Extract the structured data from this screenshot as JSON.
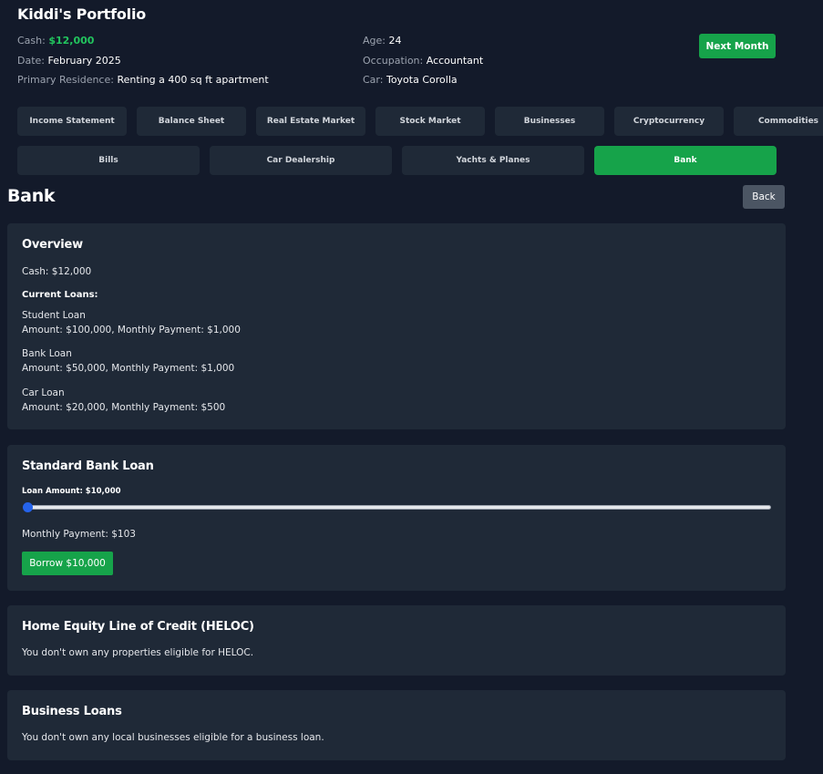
{
  "header": {
    "title": "Kiddi's Portfolio",
    "cash_label": "Cash:",
    "cash_value": "$12,000",
    "date_label": "Date:",
    "date_value": "February 2025",
    "residence_label": "Primary Residence:",
    "residence_value": "Renting a 400 sq ft apartment",
    "age_label": "Age:",
    "age_value": "24",
    "occupation_label": "Occupation:",
    "occupation_value": "Accountant",
    "car_label": "Car:",
    "car_value": "Toyota Corolla",
    "next_month_label": "Next Month"
  },
  "tabs_row1": [
    "Income Statement",
    "Balance Sheet",
    "Real Estate Market",
    "Stock Market",
    "Businesses",
    "Cryptocurrency",
    "Commodities"
  ],
  "tabs_row2": [
    "Bills",
    "Car Dealership",
    "Yachts & Planes",
    "Bank"
  ],
  "active_tab": "Bank",
  "page": {
    "title": "Bank",
    "back_label": "Back"
  },
  "overview": {
    "heading": "Overview",
    "cash": "Cash: $12,000",
    "loans_heading": "Current Loans:",
    "loans": [
      {
        "name": "Student Loan",
        "details": "Amount: $100,000, Monthly Payment: $1,000"
      },
      {
        "name": "Bank Loan",
        "details": "Amount: $50,000, Monthly Payment: $1,000"
      },
      {
        "name": "Car Loan",
        "details": "Amount: $20,000, Monthly Payment: $500"
      }
    ]
  },
  "standard_loan": {
    "heading": "Standard Bank Loan",
    "amount_label": "Loan Amount: $10,000",
    "slider_fraction": 0.0,
    "monthly_payment": "Monthly Payment: $103",
    "borrow_label": "Borrow $10,000"
  },
  "heloc": {
    "heading": "Home Equity Line of Credit (HELOC)",
    "message": "You don't own any properties eligible for HELOC."
  },
  "business_loans": {
    "heading": "Business Loans",
    "message": "You don't own any local businesses eligible for a business loan."
  },
  "colors": {
    "accent_green": "#16a34a",
    "cash_green": "#22c55e",
    "background": "#131a2a",
    "card": "#1f2937",
    "slider_thumb": "#2563eb"
  }
}
